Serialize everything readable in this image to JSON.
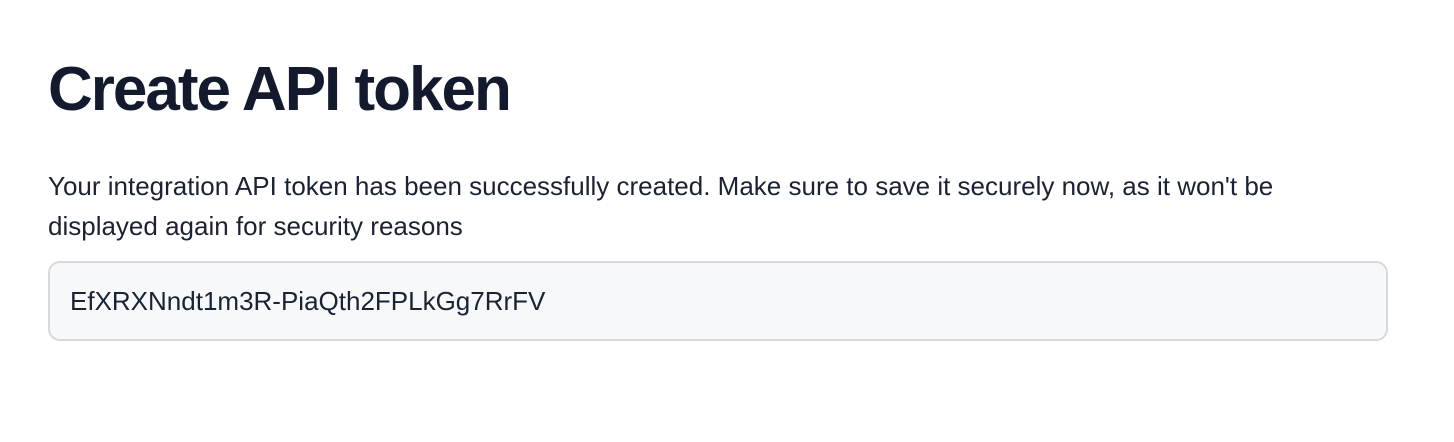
{
  "page": {
    "title": "Create API token",
    "description": "Your integration API token has been successfully created. Make sure to save it securely now, as it won't be displayed again for security reasons"
  },
  "token": {
    "value": "EfXRXNndt1m3R-PiaQth2FPLkGg7RrFV"
  },
  "colors": {
    "title": "#141a2e",
    "text": "#1b2233",
    "field_background": "#f7f8fa",
    "field_border": "#d6d9de"
  }
}
